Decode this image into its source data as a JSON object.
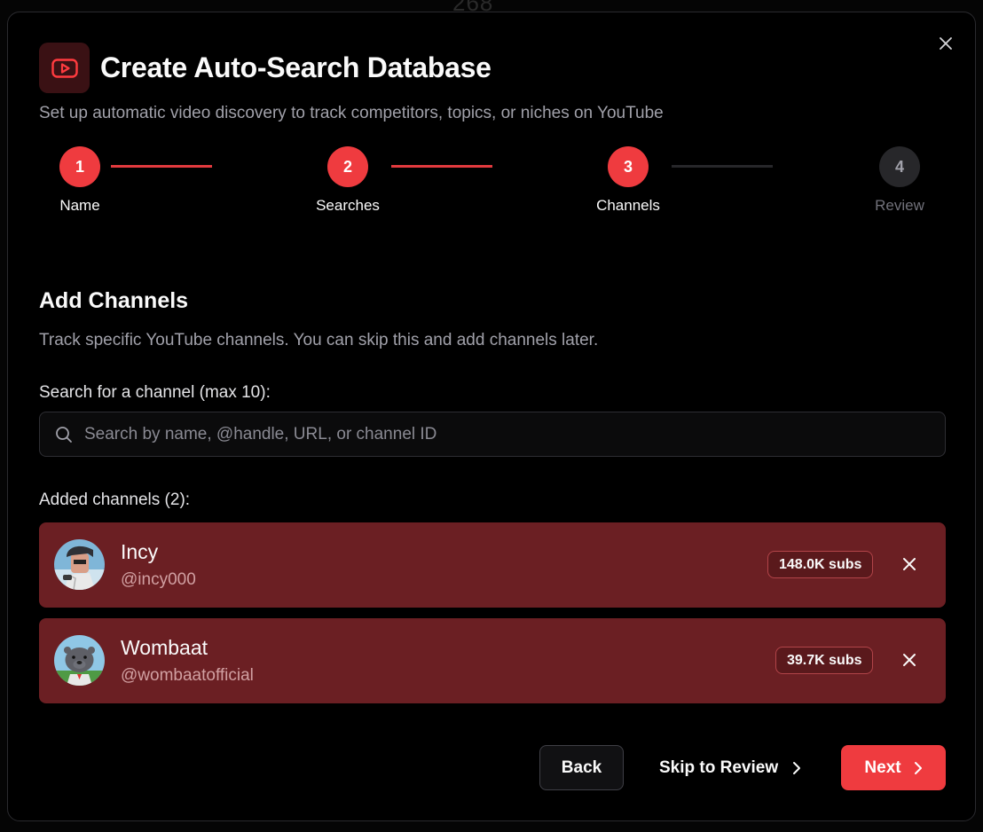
{
  "backdrop_text": "268",
  "dialog": {
    "title": "Create Auto-Search Database",
    "subtitle": "Set up automatic video discovery to track competitors, topics, or niches on YouTube",
    "logo_icon": "youtube-play-icon",
    "close_icon": "close-icon"
  },
  "steps": [
    {
      "number": "1",
      "label": "Name",
      "status": "complete"
    },
    {
      "number": "2",
      "label": "Searches",
      "status": "complete"
    },
    {
      "number": "3",
      "label": "Channels",
      "status": "current"
    },
    {
      "number": "4",
      "label": "Review",
      "status": "upcoming"
    }
  ],
  "section": {
    "title": "Add Channels",
    "description": "Track specific YouTube channels. You can skip this and add channels later."
  },
  "search": {
    "label": "Search for a channel (max 10):",
    "placeholder": "Search by name, @handle, URL, or channel ID",
    "value": ""
  },
  "added": {
    "label": "Added channels (2):",
    "channels": [
      {
        "name": "Incy",
        "handle": "@incy000",
        "subs": "148.0K subs"
      },
      {
        "name": "Wombaat",
        "handle": "@wombaatofficial",
        "subs": "39.7K subs"
      }
    ]
  },
  "footer": {
    "back_label": "Back",
    "skip_label": "Skip to Review",
    "next_label": "Next"
  },
  "colors": {
    "accent": "#ef3b3f",
    "card_bg": "#6b1f23",
    "background": "#000000"
  }
}
